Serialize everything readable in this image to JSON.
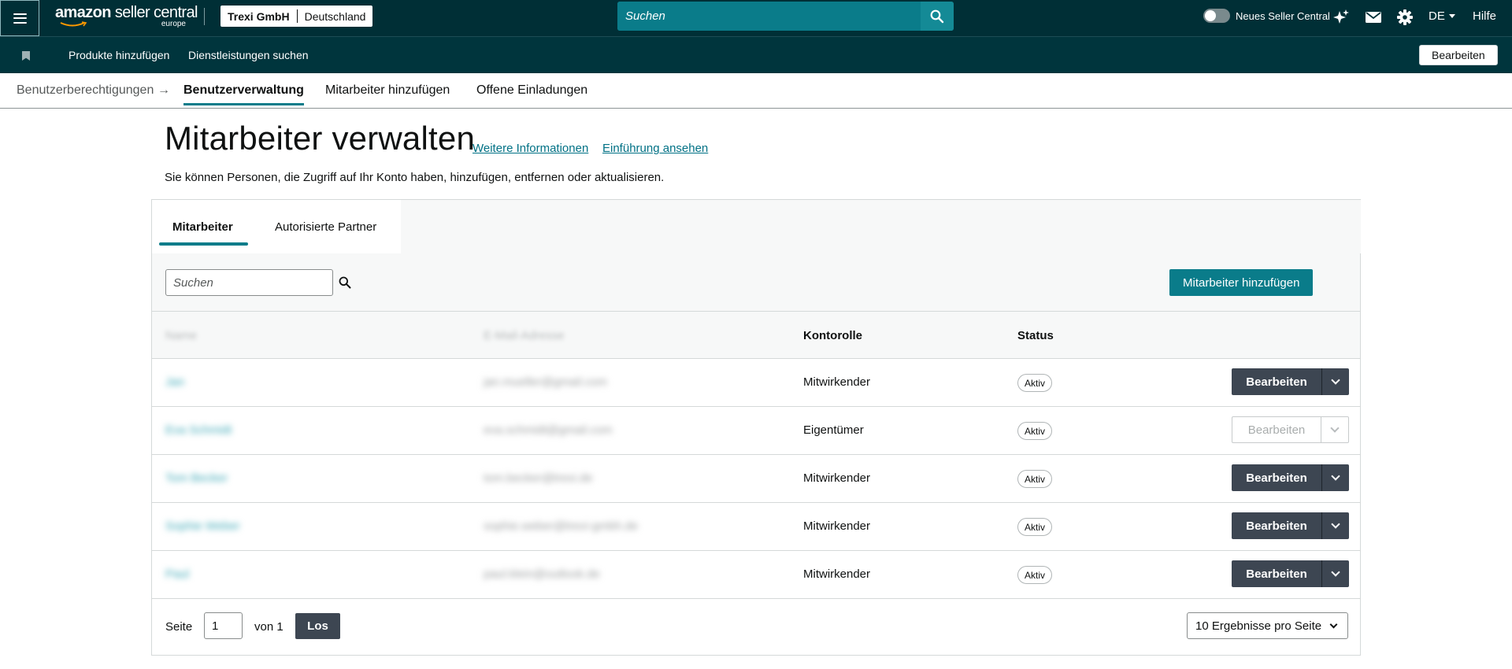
{
  "topbar": {
    "logo_text_main": "amazon",
    "logo_text_sub": "seller central",
    "logo_region": "europe",
    "account_name": "Trexi GmbH",
    "account_market": "Deutschland",
    "search_placeholder": "Suchen",
    "new_seller_central_label": "Neues Seller Central",
    "language": "DE",
    "help_label": "Hilfe",
    "icons": [
      "menu-icon",
      "search-icon",
      "sparkle-icon",
      "mail-icon",
      "gear-icon"
    ]
  },
  "subbar": {
    "links": [
      "Produkte hinzufügen",
      "Dienstleistungen suchen"
    ],
    "edit_label": "Bearbeiten"
  },
  "breadcrumb": {
    "parent": "Benutzerberechtigungen",
    "current": "Benutzerverwaltung",
    "tabs": [
      "Mitarbeiter hinzufügen",
      "Offene Einladungen"
    ]
  },
  "page": {
    "title": "Mitarbeiter verwalten",
    "link_more_info": "Weitere Informationen",
    "link_intro": "Einführung ansehen",
    "description": "Sie können Personen, die Zugriff auf Ihr Konto haben, hinzufügen, entfernen oder aktualisieren."
  },
  "card": {
    "tabs": [
      "Mitarbeiter",
      "Autorisierte Partner"
    ],
    "search_placeholder": "Suchen",
    "add_button": "Mitarbeiter hinzufügen",
    "columns": [
      "Name",
      "E-Mail-Adresse",
      "Kontorolle",
      "Status"
    ],
    "rows": [
      {
        "name": "Jan",
        "email": "jan.mueller@gmail.com",
        "role": "Mitwirkender",
        "status": "Aktiv",
        "edit": "Bearbeiten",
        "disabled": false
      },
      {
        "name": "Eva Schmidt",
        "email": "eva.schmidt@gmail.com",
        "role": "Eigentümer",
        "status": "Aktiv",
        "edit": "Bearbeiten",
        "disabled": true
      },
      {
        "name": "Tom Becker",
        "email": "tom.becker@trexi.de",
        "role": "Mitwirkender",
        "status": "Aktiv",
        "edit": "Bearbeiten",
        "disabled": false
      },
      {
        "name": "Sophie Weber",
        "email": "sophie.weber@trexi-gmbh.de",
        "role": "Mitwirkender",
        "status": "Aktiv",
        "edit": "Bearbeiten",
        "disabled": false
      },
      {
        "name": "Paul",
        "email": "paul.klein@outlook.de",
        "role": "Mitwirkender",
        "status": "Aktiv",
        "edit": "Bearbeiten",
        "disabled": false
      }
    ],
    "pager": {
      "page_label": "Seite",
      "page_value": "1",
      "of_label": "von 1",
      "go_label": "Los",
      "per_page_label": "10 Ergebnisse pro Seite"
    }
  },
  "colors": {
    "header_bg": "#002f36",
    "accent": "#0a7c8a",
    "dark_button": "#3d4652",
    "link": "#007185"
  }
}
